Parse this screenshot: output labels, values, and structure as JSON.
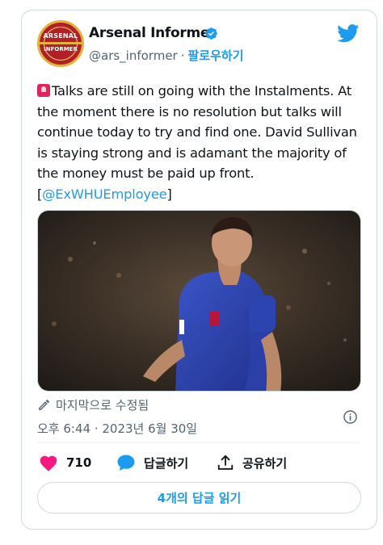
{
  "author": {
    "display_name": "Arsenal Informer",
    "handle": "@ars_informer",
    "separator": "·",
    "follow_label": "팔로우하기",
    "avatar_text_top": "ARSENAL",
    "avatar_text_bottom": "INFORMER"
  },
  "tweet": {
    "text": "Talks are still on going with the Instalments. At the moment there is no resolution but talks will continue today to try and find one. David Sullivan is staying strong and is adamant the majority of the money must be paid up front. [",
    "mention": "@ExWHUEmployee",
    "closing": "]",
    "edited_label": "마지막으로 수정됨",
    "timestamp": "오후 6:44 · 2023년 6월 30일"
  },
  "actions": {
    "like_count": "710",
    "reply_label": "답글하기",
    "share_label": "공유하기"
  },
  "read_replies_label": "4개의 답글 읽기",
  "colors": {
    "accent": "#1d9bf0",
    "like": "#f91880",
    "text": "#0f1419",
    "secondary": "#536471"
  },
  "icons": [
    "verified-badge-icon",
    "twitter-bird-icon",
    "siren-emoji-icon",
    "pencil-icon",
    "info-icon",
    "heart-icon",
    "reply-bubble-icon",
    "share-icon"
  ]
}
